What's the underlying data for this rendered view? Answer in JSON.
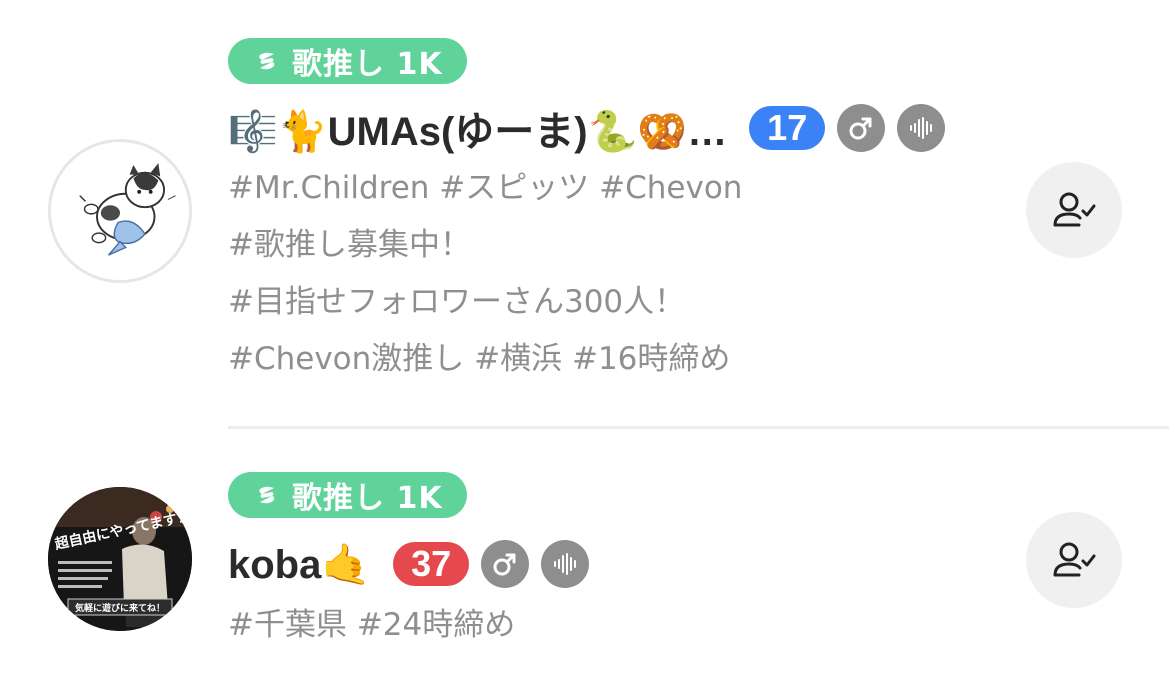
{
  "users": [
    {
      "badge": {
        "label": "歌推し 1K",
        "icon": "music-tag-icon",
        "color": "#5fd39a"
      },
      "name": "🎼🐈UMAs(ゆーま)🐍🥨…",
      "level": "17",
      "level_color": "#3b82f6",
      "gender_icon": "male-icon",
      "voice_icon": "voice-wave-icon",
      "bio": [
        "#Mr.Children #スピッツ #Chevon",
        "#歌推し募集中！",
        "#目指せフォロワーさん300人！",
        "#Chevon激推し #横浜 #16時締め"
      ],
      "follow_icon": "following-user-icon"
    },
    {
      "badge": {
        "label": "歌推し 1K",
        "icon": "music-tag-icon",
        "color": "#5fd39a"
      },
      "name": "koba🤙",
      "level": "37",
      "level_color": "#e5484d",
      "gender_icon": "male-icon",
      "voice_icon": "voice-wave-icon",
      "bio": [
        "#千葉県 #24時締め"
      ],
      "follow_icon": "following-user-icon"
    }
  ],
  "avatar_2_text": {
    "main": "超自由にやってます！",
    "footer": "気軽に遊びに来てね！"
  }
}
